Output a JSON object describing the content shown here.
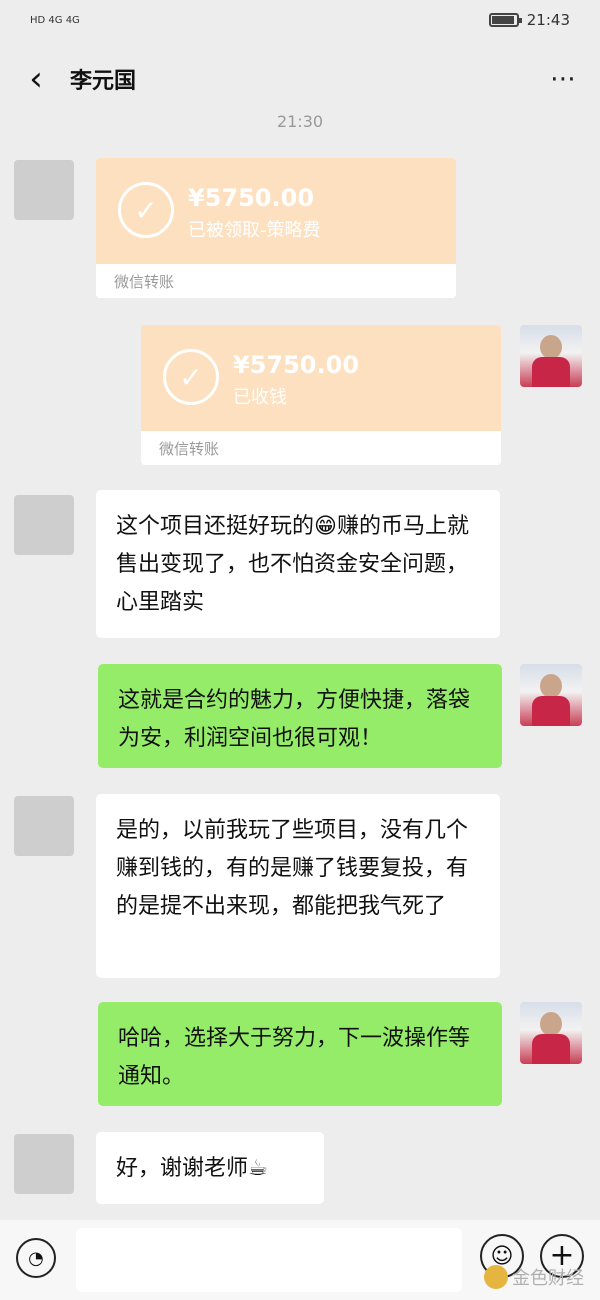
{
  "status_bar": {
    "left_indicators": "HD 4G 4G",
    "time": "21:43"
  },
  "header": {
    "title": "李元国",
    "back_icon": "chevron-left-icon",
    "more_icon": "more-dots-icon"
  },
  "chat": {
    "timestamp": "21:30",
    "transfers": [
      {
        "amount": "¥5750.00",
        "note": "已被领取-策略费",
        "footer": "微信转账"
      },
      {
        "amount": "¥5750.00",
        "note": "已收钱",
        "footer": "微信转账"
      }
    ],
    "messages": [
      {
        "text": "这个项目还挺好玩的",
        "emoji": "😁",
        "text_after": "赚的币马上就售出变现了，也不怕资金安全问题，心里踏实"
      },
      {
        "text": "这就是合约的魅力，方便快捷，落袋为安，利润空间也很可观！"
      },
      {
        "text": "是的，以前我玩了些项目，没有几个赚到钱的，有的是赚了钱要复投，有的是提不出来现，都能把我气死了"
      },
      {
        "text": "哈哈，选择大于努力，下一波操作等通知。"
      },
      {
        "text": "好，谢谢老师",
        "emoji": "☕"
      }
    ]
  },
  "input_bar": {
    "placeholder": ""
  },
  "watermark": {
    "text": "金色财经"
  }
}
